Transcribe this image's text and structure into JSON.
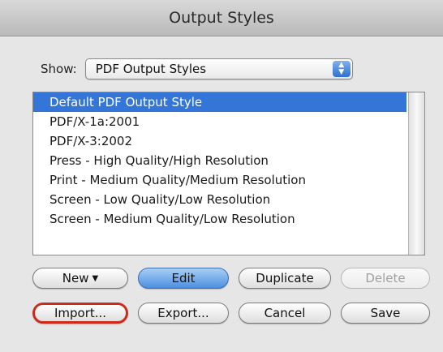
{
  "window": {
    "title": "Output Styles"
  },
  "show": {
    "label": "Show:",
    "selected": "PDF Output Styles"
  },
  "styles": [
    "Default PDF Output Style",
    "PDF/X-1a:2001",
    "PDF/X-3:2002",
    "Press - High Quality/High Resolution",
    "Print - Medium Quality/Medium Resolution",
    "Screen - Low Quality/Low Resolution",
    "Screen - Medium Quality/Low Resolution"
  ],
  "buttons": {
    "new": "New",
    "edit": "Edit",
    "duplicate": "Duplicate",
    "delete": "Delete",
    "import": "Import...",
    "export": "Export...",
    "cancel": "Cancel",
    "save": "Save"
  },
  "colors": {
    "selection": "#3476d8",
    "highlight_ring": "#cc2a1a"
  },
  "icons": {
    "new_menu": "chevron-down-icon",
    "popup_arrows": "up-down-arrows-icon"
  }
}
